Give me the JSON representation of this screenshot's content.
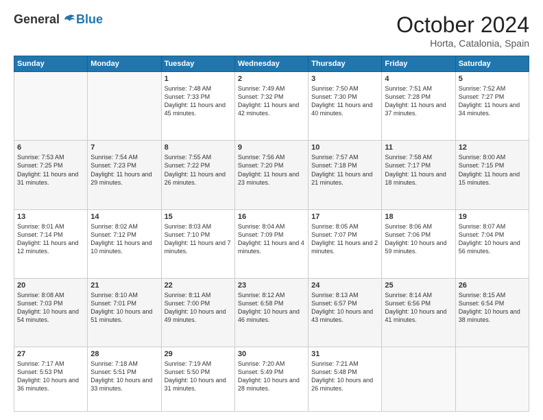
{
  "logo": {
    "general": "General",
    "blue": "Blue"
  },
  "title": "October 2024",
  "location": "Horta, Catalonia, Spain",
  "days_header": [
    "Sunday",
    "Monday",
    "Tuesday",
    "Wednesday",
    "Thursday",
    "Friday",
    "Saturday"
  ],
  "weeks": [
    [
      {
        "day": "",
        "sunrise": "",
        "sunset": "",
        "daylight": ""
      },
      {
        "day": "",
        "sunrise": "",
        "sunset": "",
        "daylight": ""
      },
      {
        "day": "1",
        "sunrise": "Sunrise: 7:48 AM",
        "sunset": "Sunset: 7:33 PM",
        "daylight": "Daylight: 11 hours and 45 minutes."
      },
      {
        "day": "2",
        "sunrise": "Sunrise: 7:49 AM",
        "sunset": "Sunset: 7:32 PM",
        "daylight": "Daylight: 11 hours and 42 minutes."
      },
      {
        "day": "3",
        "sunrise": "Sunrise: 7:50 AM",
        "sunset": "Sunset: 7:30 PM",
        "daylight": "Daylight: 11 hours and 40 minutes."
      },
      {
        "day": "4",
        "sunrise": "Sunrise: 7:51 AM",
        "sunset": "Sunset: 7:28 PM",
        "daylight": "Daylight: 11 hours and 37 minutes."
      },
      {
        "day": "5",
        "sunrise": "Sunrise: 7:52 AM",
        "sunset": "Sunset: 7:27 PM",
        "daylight": "Daylight: 11 hours and 34 minutes."
      }
    ],
    [
      {
        "day": "6",
        "sunrise": "Sunrise: 7:53 AM",
        "sunset": "Sunset: 7:25 PM",
        "daylight": "Daylight: 11 hours and 31 minutes."
      },
      {
        "day": "7",
        "sunrise": "Sunrise: 7:54 AM",
        "sunset": "Sunset: 7:23 PM",
        "daylight": "Daylight: 11 hours and 29 minutes."
      },
      {
        "day": "8",
        "sunrise": "Sunrise: 7:55 AM",
        "sunset": "Sunset: 7:22 PM",
        "daylight": "Daylight: 11 hours and 26 minutes."
      },
      {
        "day": "9",
        "sunrise": "Sunrise: 7:56 AM",
        "sunset": "Sunset: 7:20 PM",
        "daylight": "Daylight: 11 hours and 23 minutes."
      },
      {
        "day": "10",
        "sunrise": "Sunrise: 7:57 AM",
        "sunset": "Sunset: 7:18 PM",
        "daylight": "Daylight: 11 hours and 21 minutes."
      },
      {
        "day": "11",
        "sunrise": "Sunrise: 7:58 AM",
        "sunset": "Sunset: 7:17 PM",
        "daylight": "Daylight: 11 hours and 18 minutes."
      },
      {
        "day": "12",
        "sunrise": "Sunrise: 8:00 AM",
        "sunset": "Sunset: 7:15 PM",
        "daylight": "Daylight: 11 hours and 15 minutes."
      }
    ],
    [
      {
        "day": "13",
        "sunrise": "Sunrise: 8:01 AM",
        "sunset": "Sunset: 7:14 PM",
        "daylight": "Daylight: 11 hours and 12 minutes."
      },
      {
        "day": "14",
        "sunrise": "Sunrise: 8:02 AM",
        "sunset": "Sunset: 7:12 PM",
        "daylight": "Daylight: 11 hours and 10 minutes."
      },
      {
        "day": "15",
        "sunrise": "Sunrise: 8:03 AM",
        "sunset": "Sunset: 7:10 PM",
        "daylight": "Daylight: 11 hours and 7 minutes."
      },
      {
        "day": "16",
        "sunrise": "Sunrise: 8:04 AM",
        "sunset": "Sunset: 7:09 PM",
        "daylight": "Daylight: 11 hours and 4 minutes."
      },
      {
        "day": "17",
        "sunrise": "Sunrise: 8:05 AM",
        "sunset": "Sunset: 7:07 PM",
        "daylight": "Daylight: 11 hours and 2 minutes."
      },
      {
        "day": "18",
        "sunrise": "Sunrise: 8:06 AM",
        "sunset": "Sunset: 7:06 PM",
        "daylight": "Daylight: 10 hours and 59 minutes."
      },
      {
        "day": "19",
        "sunrise": "Sunrise: 8:07 AM",
        "sunset": "Sunset: 7:04 PM",
        "daylight": "Daylight: 10 hours and 56 minutes."
      }
    ],
    [
      {
        "day": "20",
        "sunrise": "Sunrise: 8:08 AM",
        "sunset": "Sunset: 7:03 PM",
        "daylight": "Daylight: 10 hours and 54 minutes."
      },
      {
        "day": "21",
        "sunrise": "Sunrise: 8:10 AM",
        "sunset": "Sunset: 7:01 PM",
        "daylight": "Daylight: 10 hours and 51 minutes."
      },
      {
        "day": "22",
        "sunrise": "Sunrise: 8:11 AM",
        "sunset": "Sunset: 7:00 PM",
        "daylight": "Daylight: 10 hours and 49 minutes."
      },
      {
        "day": "23",
        "sunrise": "Sunrise: 8:12 AM",
        "sunset": "Sunset: 6:58 PM",
        "daylight": "Daylight: 10 hours and 46 minutes."
      },
      {
        "day": "24",
        "sunrise": "Sunrise: 8:13 AM",
        "sunset": "Sunset: 6:57 PM",
        "daylight": "Daylight: 10 hours and 43 minutes."
      },
      {
        "day": "25",
        "sunrise": "Sunrise: 8:14 AM",
        "sunset": "Sunset: 6:56 PM",
        "daylight": "Daylight: 10 hours and 41 minutes."
      },
      {
        "day": "26",
        "sunrise": "Sunrise: 8:15 AM",
        "sunset": "Sunset: 6:54 PM",
        "daylight": "Daylight: 10 hours and 38 minutes."
      }
    ],
    [
      {
        "day": "27",
        "sunrise": "Sunrise: 7:17 AM",
        "sunset": "Sunset: 5:53 PM",
        "daylight": "Daylight: 10 hours and 36 minutes."
      },
      {
        "day": "28",
        "sunrise": "Sunrise: 7:18 AM",
        "sunset": "Sunset: 5:51 PM",
        "daylight": "Daylight: 10 hours and 33 minutes."
      },
      {
        "day": "29",
        "sunrise": "Sunrise: 7:19 AM",
        "sunset": "Sunset: 5:50 PM",
        "daylight": "Daylight: 10 hours and 31 minutes."
      },
      {
        "day": "30",
        "sunrise": "Sunrise: 7:20 AM",
        "sunset": "Sunset: 5:49 PM",
        "daylight": "Daylight: 10 hours and 28 minutes."
      },
      {
        "day": "31",
        "sunrise": "Sunrise: 7:21 AM",
        "sunset": "Sunset: 5:48 PM",
        "daylight": "Daylight: 10 hours and 26 minutes."
      },
      {
        "day": "",
        "sunrise": "",
        "sunset": "",
        "daylight": ""
      },
      {
        "day": "",
        "sunrise": "",
        "sunset": "",
        "daylight": ""
      }
    ]
  ]
}
